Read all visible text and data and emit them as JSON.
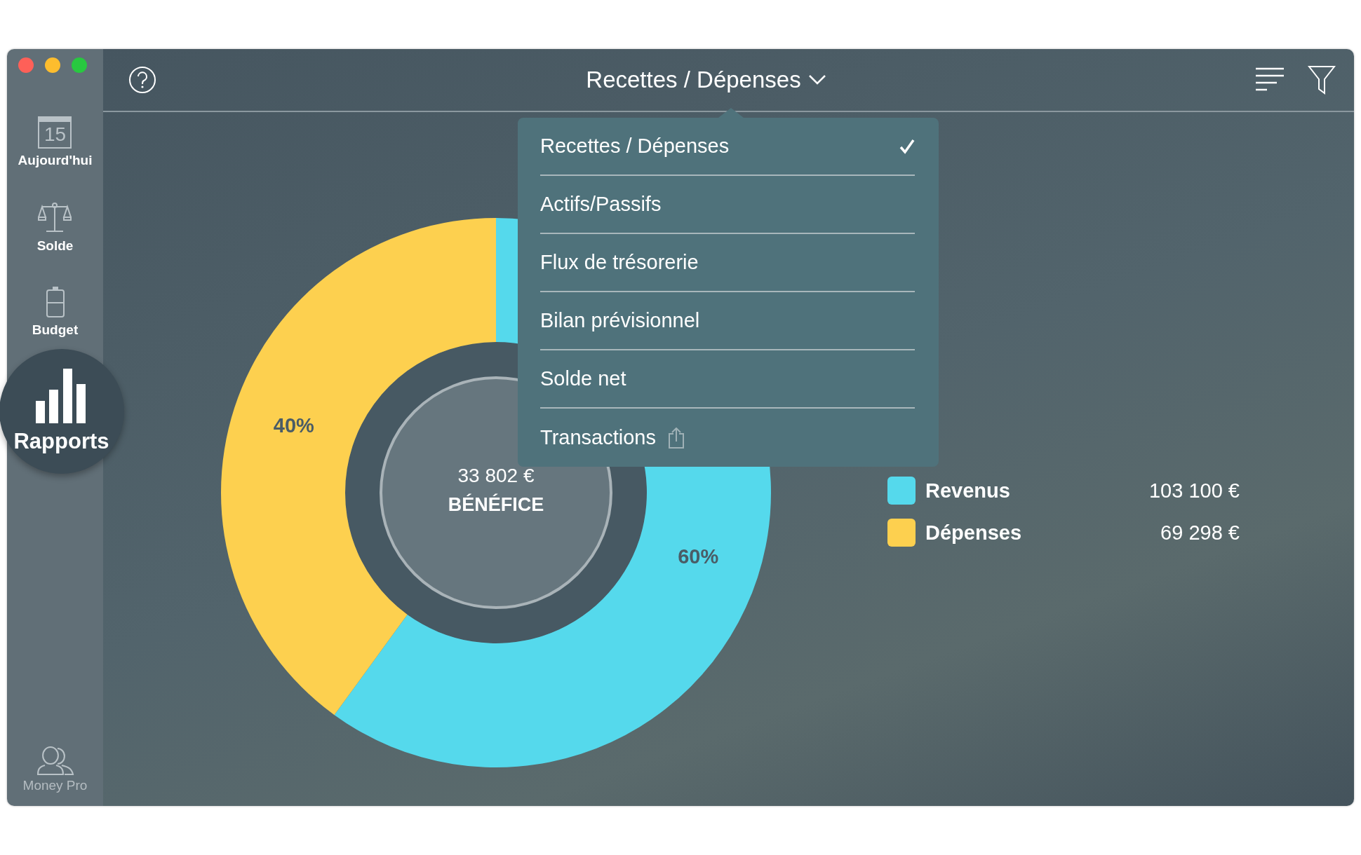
{
  "sidebar": {
    "items": [
      {
        "kind": "calendar",
        "day": "15",
        "label": "Aujourd'hui",
        "selected": false
      },
      {
        "kind": "scale",
        "label": "Solde",
        "selected": false
      },
      {
        "kind": "jar",
        "label": "Budget",
        "selected": false
      },
      {
        "kind": "bars",
        "label": "Rapports",
        "selected": true
      }
    ],
    "footer": {
      "label": "Money Pro"
    }
  },
  "toolbar": {
    "title": "Recettes / Dépenses"
  },
  "report_menu": {
    "items": [
      {
        "label": "Recettes / Dépenses",
        "selected": true,
        "kind": "plain"
      },
      {
        "label": "Actifs/Passifs",
        "selected": false,
        "kind": "plain"
      },
      {
        "label": "Flux de trésorerie",
        "selected": false,
        "kind": "plain"
      },
      {
        "label": "Bilan prévisionnel",
        "selected": false,
        "kind": "plain"
      },
      {
        "label": "Solde net",
        "selected": false,
        "kind": "plain"
      },
      {
        "label": "Transactions",
        "selected": false,
        "kind": "export"
      }
    ]
  },
  "chart": {
    "center_value": "33 802 €",
    "center_label": "BÉNÉFICE",
    "chart_data": {
      "type": "donut",
      "categories": [
        "Revenus",
        "Dépenses"
      ],
      "values": [
        60,
        40
      ],
      "value_labels": [
        "60%",
        "40%"
      ]
    }
  },
  "legend": [
    {
      "amount": "103 100 €",
      "color": "#55d9ec"
    },
    {
      "amount": "69 298 €",
      "color": "#fdd04f"
    }
  ]
}
